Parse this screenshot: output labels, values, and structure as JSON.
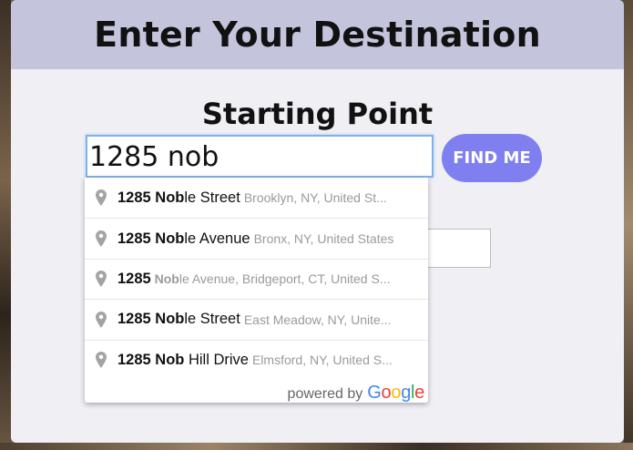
{
  "page_title": "Enter Your Destination",
  "starting_point": {
    "label": "Starting Point",
    "input_value": "1285 nob",
    "find_me_label": "FIND ME"
  },
  "autocomplete": {
    "items": [
      {
        "match": "1285 Nob",
        "rest": "le Street",
        "secondary": "Brooklyn, NY, United St..."
      },
      {
        "match": "1285 Nob",
        "rest": "le Avenue",
        "secondary": "Bronx, NY, United States"
      },
      {
        "match": "1285",
        "rest": "",
        "secondary_bold": "Nob",
        "secondary": "le Avenue, Bridgeport, CT, United S..."
      },
      {
        "match": "1285 Nob",
        "rest": "le Street",
        "secondary": "East Meadow, NY, Unite..."
      },
      {
        "match": "1285 Nob",
        "rest": " Hill Drive",
        "secondary": "Elmsford, NY, United S..."
      }
    ],
    "powered_by": "powered by",
    "google_letters": [
      "G",
      "o",
      "o",
      "g",
      "l",
      "e"
    ]
  },
  "colors": {
    "header_bg": "#c4c5dc",
    "button_bg": "#7f7ff0",
    "input_focus_border": "#7fb1ea",
    "pin_icon": "#a3a3a3"
  },
  "icons": {
    "suggestion_icon": "map-pin-icon"
  }
}
